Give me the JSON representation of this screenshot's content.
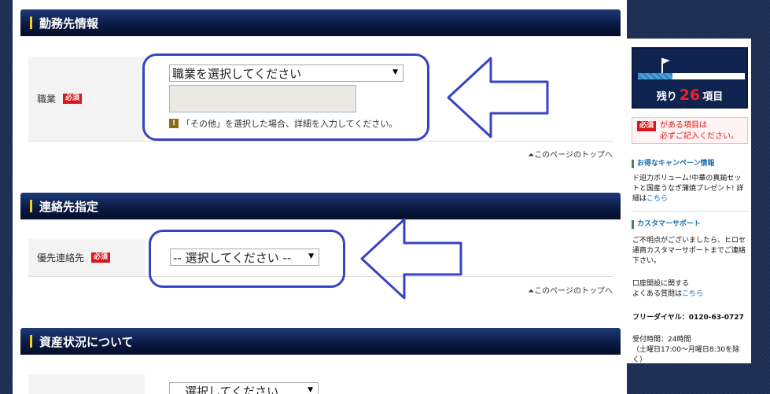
{
  "sections": {
    "workplace": {
      "title": "勤務先情報"
    },
    "contact": {
      "title": "連絡先指定"
    },
    "assets": {
      "title": "資産状況について"
    }
  },
  "form": {
    "required_badge": "必須",
    "occupation": {
      "label": "職業",
      "select_value": "職業を選択してください",
      "note": "「その他」を選択した場合、詳細を入力してください。"
    },
    "preferred_contact": {
      "label": "優先連絡先",
      "select_value": "-- 選択してください --"
    },
    "assets_select_value": "選択してください"
  },
  "page_top_link": "このページのトップへ",
  "sidebar": {
    "remaining_prefix": "残り",
    "remaining_count": "26",
    "remaining_suffix": "項目",
    "progress_fraction": 0.32,
    "required_badge": "必須",
    "required_note_line1": "がある項目は",
    "required_note_line2": "必ずご記入ください。",
    "campaign_title": "お得なキャンペーン情報",
    "campaign_text": "ド迫力ボリューム!中華の真鍮セットと国産うなぎ蒲焼プレゼント! 詳細は",
    "campaign_link": "こちら",
    "support_title": "カスタマーサポート",
    "support_text": "ご不明点がございましたら、ヒロセ通商カスタマーサポートまでご連絡下さい。",
    "faq_line1": "口座開設に関する",
    "faq_line2": "よくある質問は",
    "faq_link": "こちら",
    "freedial": "フリーダイヤル：0120-63-0727",
    "hours_line1": "受付時間：24時間",
    "hours_line2": "（土曜日17:00～月曜日8:30を除く）"
  },
  "colors": {
    "header_bg": "#0a1840",
    "header_accent": "#f2d21a",
    "required_red": "#d9171c",
    "annotation_blue": "#3743c4",
    "remaining_red": "#e8212a"
  }
}
